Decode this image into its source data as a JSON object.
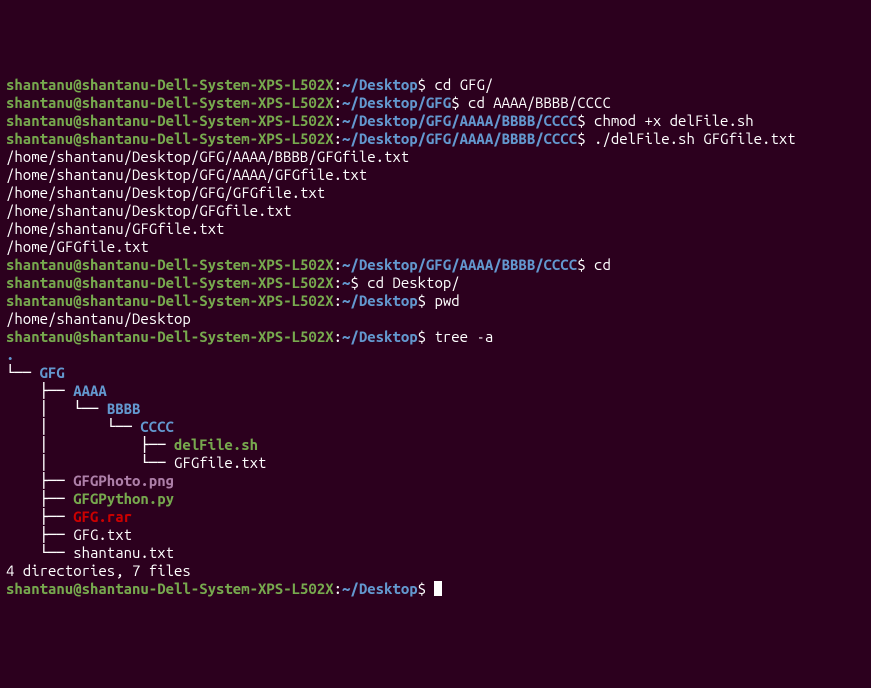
{
  "user": "shantanu",
  "host": "shantanu-Dell-System-XPS-L502X",
  "lines": [
    {
      "type": "prompt",
      "path": "~/Desktop",
      "cmd": "cd GFG/"
    },
    {
      "type": "prompt",
      "path": "~/Desktop/GFG",
      "cmd": "cd AAAA/BBBB/CCCC"
    },
    {
      "type": "prompt",
      "path": "~/Desktop/GFG/AAAA/BBBB/CCCC",
      "cmd": "chmod +x delFile.sh"
    },
    {
      "type": "prompt",
      "path": "~/Desktop/GFG/AAAA/BBBB/CCCC",
      "cmd": "./delFile.sh GFGfile.txt"
    },
    {
      "type": "output",
      "text": "/home/shantanu/Desktop/GFG/AAAA/BBBB/GFGfile.txt"
    },
    {
      "type": "output",
      "text": "/home/shantanu/Desktop/GFG/AAAA/GFGfile.txt"
    },
    {
      "type": "output",
      "text": "/home/shantanu/Desktop/GFG/GFGfile.txt"
    },
    {
      "type": "output",
      "text": "/home/shantanu/Desktop/GFGfile.txt"
    },
    {
      "type": "output",
      "text": "/home/shantanu/GFGfile.txt"
    },
    {
      "type": "output",
      "text": "/home/GFGfile.txt"
    },
    {
      "type": "prompt",
      "path": "~/Desktop/GFG/AAAA/BBBB/CCCC",
      "cmd": "cd"
    },
    {
      "type": "prompt",
      "path": "~",
      "cmd": "cd Desktop/"
    },
    {
      "type": "prompt",
      "path": "~/Desktop",
      "cmd": "pwd"
    },
    {
      "type": "output",
      "text": "/home/shantanu/Desktop"
    },
    {
      "type": "prompt",
      "path": "~/Desktop",
      "cmd": "tree -a"
    }
  ],
  "tree_root_dot": ".",
  "tree": [
    {
      "branch": "└── ",
      "name": "GFG",
      "cls": "tree-dir"
    },
    {
      "branch": "    ├── ",
      "name": "AAAA",
      "cls": "tree-dir"
    },
    {
      "branch": "    │   └── ",
      "name": "BBBB",
      "cls": "tree-dir"
    },
    {
      "branch": "    │       └── ",
      "name": "CCCC",
      "cls": "tree-dir"
    },
    {
      "branch": "    │           ├── ",
      "name": "delFile.sh",
      "cls": "tree-exec"
    },
    {
      "branch": "    │           └── ",
      "name": "GFGfile.txt",
      "cls": "tree-file"
    },
    {
      "branch": "    ├── ",
      "name": "GFGPhoto.png",
      "cls": "tree-img"
    },
    {
      "branch": "    ├── ",
      "name": "GFGPython.py",
      "cls": "tree-exec"
    },
    {
      "branch": "    ├── ",
      "name": "GFG.rar",
      "cls": "tree-arc"
    },
    {
      "branch": "    ├── ",
      "name": "GFG.txt",
      "cls": "tree-file"
    },
    {
      "branch": "    └── ",
      "name": "shantanu.txt",
      "cls": "tree-file"
    }
  ],
  "tree_summary_blank": "",
  "tree_summary": "4 directories, 7 files",
  "final_prompt": {
    "path": "~/Desktop",
    "cmd": ""
  }
}
